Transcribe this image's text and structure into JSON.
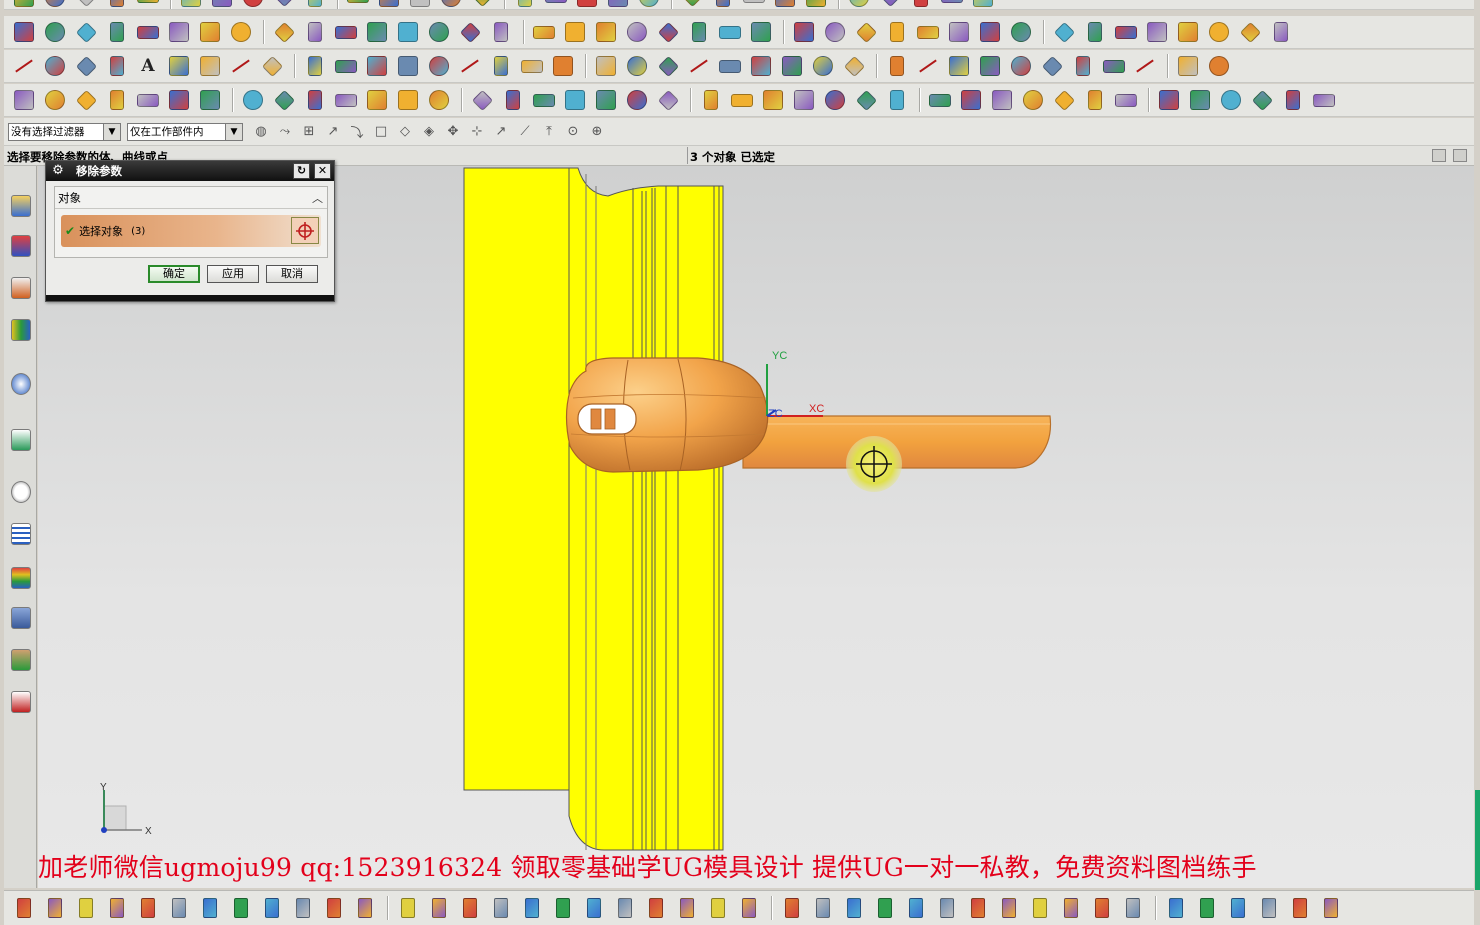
{
  "selection_bar": {
    "filter_value": "没有选择过滤器",
    "scope_value": "仅在工作部件内"
  },
  "status": {
    "prompt": "选择要移除参数的体、曲线或点",
    "selection_count": "3 个对象 已选定"
  },
  "dialog": {
    "title": "移除参数",
    "group_label": "对象",
    "select_label": "选择对象",
    "select_count": "(3)",
    "ok_label": "确定",
    "apply_label": "应用",
    "cancel_label": "取消"
  },
  "viewport": {
    "wcs_labels": {
      "x": "XC",
      "y": "YC",
      "z": "ZC"
    },
    "triad_labels": {
      "x": "X",
      "y": "Y"
    }
  },
  "watermark": "加老师微信ugmoju99  qq:1523916324 领取零基础学UG模具设计  提供UG一对一私教，免费资料图档练手",
  "colors": {
    "part_yellow": "#ffff00",
    "handle_orange": "#f2a23e",
    "accent_orange": "#e0883f",
    "watermark_red": "#e3001b",
    "dialog_title": "#1a1a1a"
  },
  "toolbars": {
    "row1_icons": [
      "new-file-icon",
      "block-icon",
      "cylinder-icon",
      "sphere-icon",
      "extrude-icon",
      "revolve-icon",
      "hole-icon",
      "boss-icon",
      "pocket-icon",
      "pad-icon",
      "slot-icon",
      "groove-icon",
      "datum-plane-icon",
      "datum-axis-icon",
      "sketch-icon",
      "instance-icon",
      "mirror-icon",
      "unite-icon",
      "subtract-icon",
      "intersect-icon",
      "edge-blend-icon",
      "chamfer-icon",
      "shell-icon",
      "draft-icon",
      "offset-face-icon",
      "scale-body-icon",
      "trim-body-icon",
      "split-body-icon",
      "sew-icon",
      "patch-icon",
      "thicken-icon",
      "extract-icon",
      "wave-link-icon",
      "move-face-icon",
      "replace-face-icon",
      "delete-face-icon",
      "resize-face-icon",
      "pattern-face-icon",
      "mirror-face-icon",
      "copy-face-icon"
    ],
    "row2_icons": [
      "line-icon",
      "arc-icon",
      "rectangle-icon",
      "spline-icon",
      "text-icon",
      "polygon-icon",
      "ellipse-icon",
      "helix-icon",
      "offset-curve-icon",
      "bridge-curve-icon",
      "project-curve-icon",
      "join-curve-icon",
      "trim-curve-icon",
      "divide-curve-icon",
      "curve-length-icon",
      "section-curve-icon",
      "intersect-curve-icon",
      "isoparametric-icon",
      "edge-curve-icon",
      "extract-curve-icon",
      "wrap-curve-icon",
      "measure-icon",
      "analysis-icon",
      "swept-icon",
      "through-curves-icon",
      "ruled-icon",
      "n-sided-icon",
      "studio-surface-icon",
      "styled-sweep-icon",
      "law-extension-icon",
      "offset-surface-icon",
      "trim-sheet-icon",
      "bounded-plane-icon",
      "quilt-icon",
      "global-shape-icon",
      "x-form-icon",
      "clay-icon",
      "face-blend-icon"
    ],
    "row3_icons": [
      "annotation-icon",
      "dimension-icon",
      "view-front-icon",
      "view-iso-icon",
      "layer-icon",
      "wcs-icon",
      "shaded-icon",
      "wireframe-icon",
      "section-icon",
      "fit-icon",
      "zoom-icon",
      "rotate-icon",
      "pan-icon",
      "orient-icon",
      "snap-icon",
      "point-icon",
      "vector-icon",
      "csys-icon",
      "plane-icon",
      "measure-distance-icon",
      "measure-angle-icon",
      "info-icon",
      "layer-settings-icon",
      "move-to-layer-icon",
      "copy-to-layer-icon",
      "hide-icon",
      "show-icon",
      "invert-icon",
      "blank-icon",
      "unblank-icon",
      "color-icon",
      "edit-object-icon",
      "transform-icon",
      "delete-icon",
      "undo-icon",
      "redo-icon",
      "grid-icon",
      "chart-icon",
      "table-icon",
      "spreadsheet-icon",
      "render-icon"
    ],
    "selection_icons": [
      "filter-icon",
      "snap-point-icon",
      "end-point-icon",
      "mid-point-icon",
      "center-point-icon",
      "quadrant-icon",
      "intersect-point-icon",
      "existing-point-icon",
      "point-on-curve-icon",
      "point-on-face-icon",
      "select-all-icon",
      "deselect-icon",
      "feature-icon",
      "body-icon",
      "face-icon"
    ],
    "bottom_icons": [
      "mold-csys-icon",
      "shrinkage-icon",
      "workpiece-icon",
      "cavity-layout-icon",
      "family-mold-icon",
      "mold-tools-icon",
      "parting-icon",
      "mold-base-icon",
      "standard-part-icon",
      "ejector-icon",
      "slider-lifter-icon",
      "subinsert-icon",
      "gate-icon",
      "runner-icon",
      "cooling-icon",
      "electrode-icon",
      "trim-mold-icon",
      "pocket-icon",
      "bom-icon",
      "drawing-icon",
      "casting-icon",
      "view-manager-icon",
      "unused-icon",
      "delete-files-icon",
      "mold-wizard-icon",
      "line-tool-icon",
      "offset-line-icon",
      "rotate-tool-icon",
      "extend-icon",
      "copy-icon",
      "edit-icon",
      "move-icon",
      "array-icon",
      "bounding-box-icon",
      "region-icon",
      "face-split-icon",
      "check-region-icon",
      "patch-surface-icon",
      "extend-sheet-icon",
      "sheet-body-icon",
      "solid-body-icon",
      "color-face-icon"
    ]
  }
}
